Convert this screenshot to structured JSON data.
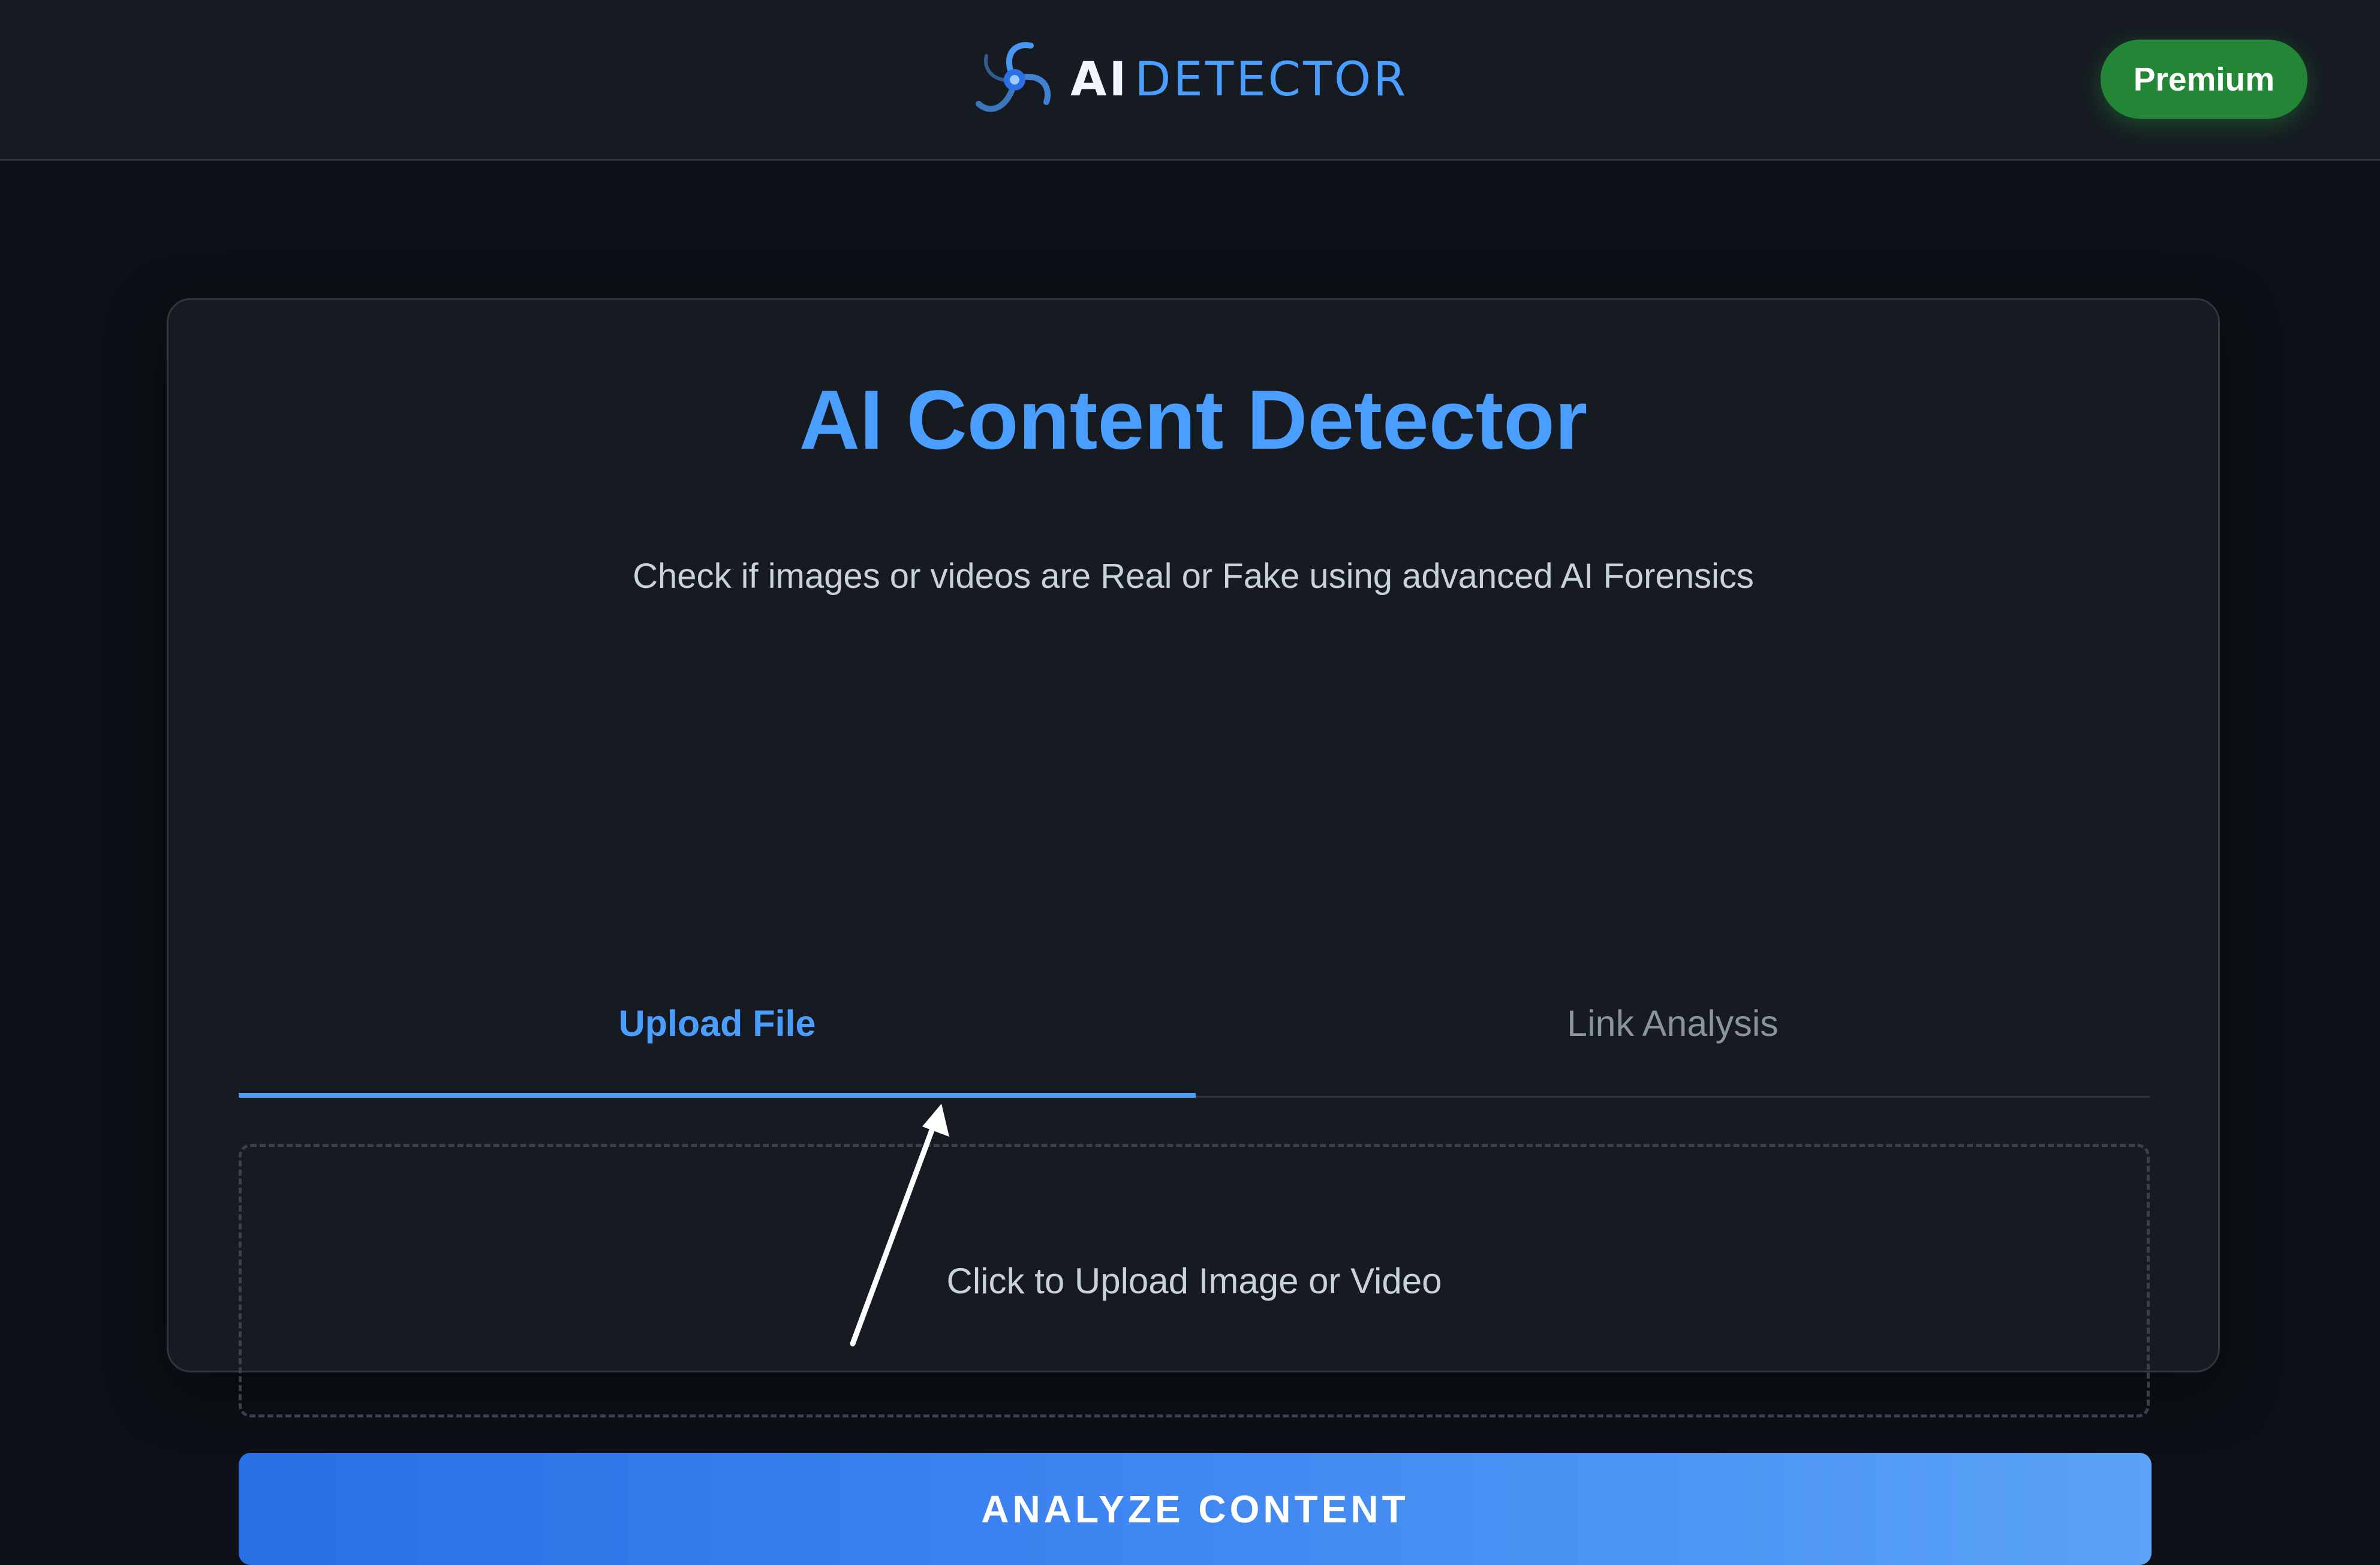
{
  "header": {
    "logo": {
      "icon": "swirl-logo-icon",
      "text_primary": "AI",
      "text_secondary": "DETECTOR"
    },
    "premium_label": "Premium"
  },
  "main": {
    "title": "AI Content Detector",
    "subtitle": "Check if images or videos are Real or Fake using advanced AI Forensics",
    "tabs": [
      {
        "label": "Upload File",
        "active": true
      },
      {
        "label": "Link Analysis",
        "active": false
      }
    ],
    "dropzone_label": "Click to Upload Image or Video",
    "analyze_label": "ANALYZE CONTENT"
  },
  "colors": {
    "background": "#0d1117",
    "panel": "#161b22",
    "accent": "#4a9eff",
    "premium": "#238636",
    "text": "#c9d1d9",
    "muted": "#8b949e"
  }
}
